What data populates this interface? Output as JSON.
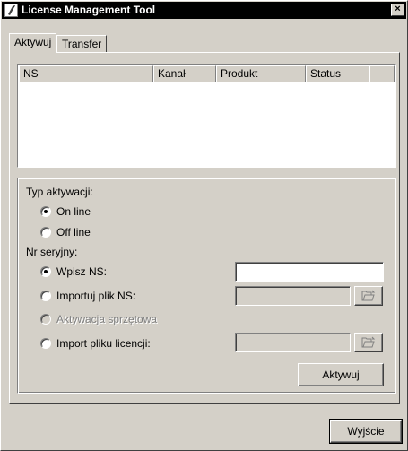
{
  "window": {
    "title": "License Management Tool",
    "close_glyph": "×"
  },
  "tabs": [
    {
      "label": "Aktywuj",
      "active": true
    },
    {
      "label": "Transfer",
      "active": false
    }
  ],
  "list": {
    "columns": [
      "NS",
      "Kanał",
      "Produkt",
      "Status"
    ],
    "rows": []
  },
  "activation": {
    "type_label": "Typ aktywacji:",
    "online_label": "On line",
    "offline_label": "Off line",
    "online_checked": true,
    "serial_label": "Nr seryjny:",
    "enter_ns_label": "Wpisz NS:",
    "enter_ns_value": "",
    "import_ns_label": "Importuj plik NS:",
    "hardware_label": "Aktywacja sprzętowa",
    "import_license_label": "Import pliku licencji:",
    "activate_button": "Aktywuj"
  },
  "footer": {
    "exit_button": "Wyjście"
  },
  "icons": {
    "app": "app-icon",
    "folder": "folder-open-icon"
  }
}
